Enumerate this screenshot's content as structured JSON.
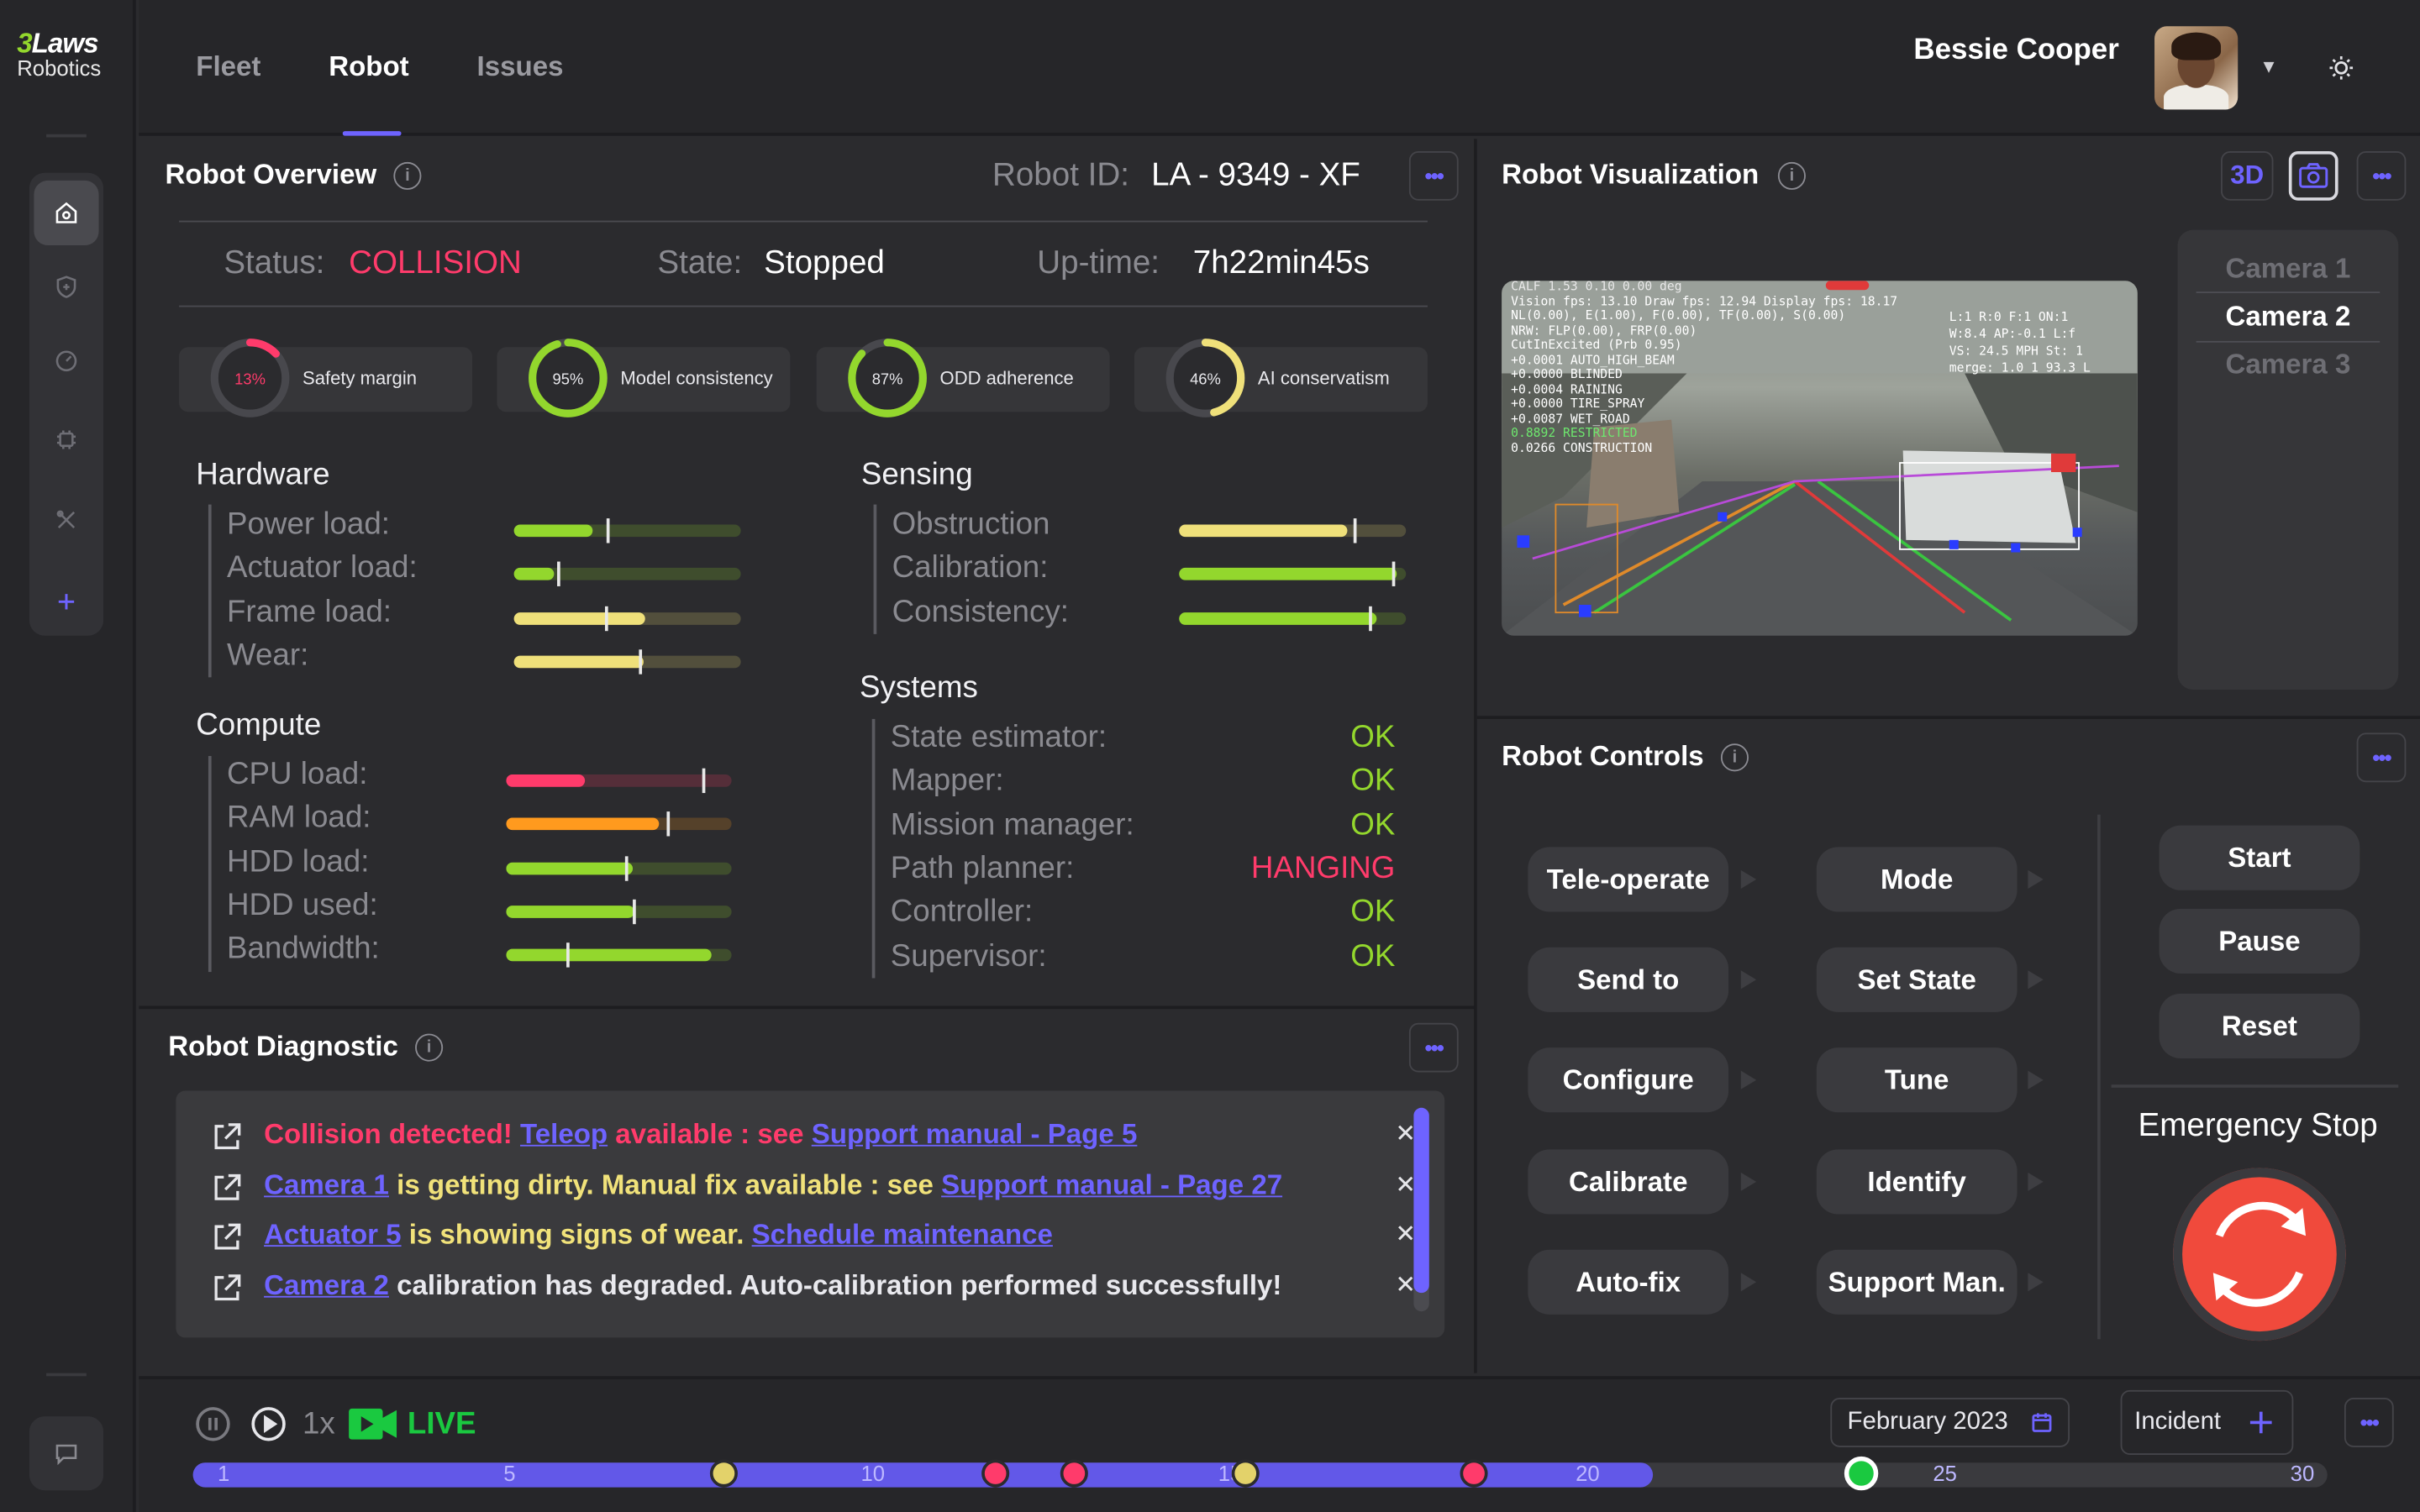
{
  "brand": {
    "line1_num": "3",
    "line1_word": "Laws",
    "line2": "Robotics"
  },
  "nav": {
    "tabs": [
      "Fleet",
      "Robot",
      "Issues"
    ],
    "active": "Robot"
  },
  "user": {
    "name": "Bessie Cooper"
  },
  "overview": {
    "title": "Robot Overview",
    "robot_id_label": "Robot ID:",
    "robot_id": "LA - 9349 - XF",
    "status_label": "Status:",
    "status": "COLLISION",
    "state_label": "State:",
    "state": "Stopped",
    "uptime_label": "Up-time:",
    "uptime": "7h22min45s",
    "gauges": [
      {
        "pct_text": "13%",
        "value": 0.13,
        "label": "Safety margin",
        "color": "#ff3b6b"
      },
      {
        "pct_text": "95%",
        "value": 0.95,
        "label": "Model consistency",
        "color": "#93d72d"
      },
      {
        "pct_text": "87%",
        "value": 0.87,
        "label": "ODD adherence",
        "color": "#93d72d"
      },
      {
        "pct_text": "46%",
        "value": 0.46,
        "label": "AI conservatism",
        "color": "#efe07a"
      }
    ],
    "hardware": {
      "title": "Hardware",
      "rows": [
        {
          "label": "Power load:",
          "fill": 0.35,
          "tick": 0.41,
          "color": "#93d72d"
        },
        {
          "label": "Actuator load:",
          "fill": 0.18,
          "tick": 0.19,
          "color": "#93d72d"
        },
        {
          "label": "Frame load:",
          "fill": 0.58,
          "tick": 0.4,
          "color": "#efe07a"
        },
        {
          "label": "Wear:",
          "fill": 0.57,
          "tick": 0.55,
          "color": "#efe07a"
        }
      ]
    },
    "compute": {
      "title": "Compute",
      "rows": [
        {
          "label": "CPU load:",
          "fill": 0.35,
          "tick": 0.87,
          "color": "#ff3b6b"
        },
        {
          "label": "RAM load:",
          "fill": 0.68,
          "tick": 0.71,
          "color": "#ff9a1e"
        },
        {
          "label": "HDD load:",
          "fill": 0.56,
          "tick": 0.53,
          "color": "#93d72d"
        },
        {
          "label": "HDD used:",
          "fill": 0.57,
          "tick": 0.56,
          "color": "#93d72d"
        },
        {
          "label": "Bandwidth:",
          "fill": 0.91,
          "tick": 0.27,
          "color": "#93d72d"
        }
      ]
    },
    "sensing": {
      "title": "Sensing",
      "rows": [
        {
          "label": "Obstruction",
          "fill": 0.74,
          "tick": 0.77,
          "color": "#efe07a"
        },
        {
          "label": "Calibration:",
          "fill": 0.96,
          "tick": 0.94,
          "color": "#93d72d"
        },
        {
          "label": "Consistency:",
          "fill": 0.87,
          "tick": 0.84,
          "color": "#93d72d"
        }
      ]
    },
    "systems": {
      "title": "Systems",
      "rows": [
        {
          "label": "State estimator:",
          "value": "OK",
          "color": "#93d72d"
        },
        {
          "label": "Mapper:",
          "value": "OK",
          "color": "#93d72d"
        },
        {
          "label": "Mission manager:",
          "value": "OK",
          "color": "#93d72d"
        },
        {
          "label": "Path planner:",
          "value": "HANGING",
          "color": "#ff3b6b"
        },
        {
          "label": "Controller:",
          "value": "OK",
          "color": "#93d72d"
        },
        {
          "label": "Supervisor:",
          "value": "OK",
          "color": "#93d72d"
        }
      ]
    }
  },
  "diagnostic": {
    "title": "Robot Diagnostic",
    "messages": [
      {
        "parts": [
          {
            "t": "Collision detected! ",
            "c": "c-red"
          },
          {
            "t": "Teleop",
            "c": "lnk"
          },
          {
            "t": " available : see ",
            "c": "c-red"
          },
          {
            "t": "Support manual - Page 5",
            "c": "lnk"
          }
        ]
      },
      {
        "parts": [
          {
            "t": "Camera 1",
            "c": "lnk"
          },
          {
            "t": " is getting dirty. Manual fix available : see ",
            "c": "c-yel"
          },
          {
            "t": "Support manual - Page 27",
            "c": "lnk"
          }
        ]
      },
      {
        "parts": [
          {
            "t": "Actuator 5",
            "c": "lnk"
          },
          {
            "t": " is showing signs of wear. ",
            "c": "c-yel"
          },
          {
            "t": "Schedule maintenance",
            "c": "lnk"
          }
        ]
      },
      {
        "parts": [
          {
            "t": "Camera 2",
            "c": "lnk"
          },
          {
            "t": " calibration has degraded. Auto-calibration performed successfully!",
            "c": "c-wht"
          }
        ]
      }
    ]
  },
  "visualization": {
    "title": "Robot Visualization",
    "btn_3d": "3D",
    "cameras": [
      "Camera 1",
      "Camera 2",
      "Camera 3"
    ],
    "active_camera": "Camera 2",
    "overlay_left": [
      "Vision fps: 13.10 Draw fps: 12.94 Display fps: 18.17",
      "NL(0.00), E(1.00), F(0.00), TF(0.00), S(0.00)",
      "NRW: FLP(0.00), FRP(0.00)",
      "CutInExcited (Prb 0.95)",
      "+0.0001 AUTO_HIGH_BEAM",
      "+0.0000 BLINDED",
      "+0.0004 RAINING",
      "+0.0000 TIRE_SPRAY",
      "+0.0087 WET_ROAD",
      "0.8892 RESTRICTED",
      "0.0266 CONSTRUCTION"
    ],
    "overlay_right": [
      "L:1  R:0  F:1  ON:1",
      "W:8.4  AP:-0.1  L:f",
      "VS: 24.5 MPH  St: 1",
      "merge: 1.0  1  93.3  L"
    ],
    "overlay_top": "CALF  1.53  0.10  0.00 deg"
  },
  "controls": {
    "title": "Robot Controls",
    "left_col": [
      "Tele-operate",
      "Send to",
      "Configure",
      "Calibrate",
      "Auto-fix"
    ],
    "mid_col": [
      "Mode",
      "Set State",
      "Tune",
      "Identify",
      "Support Man."
    ],
    "actions": [
      "Start",
      "Pause",
      "Reset"
    ],
    "estop_label": "Emergency Stop"
  },
  "timeline": {
    "speed": "1x",
    "live": "LIVE",
    "date": "February 2023",
    "incident": "Incident",
    "ticks": [
      {
        "n": "1",
        "v": 1
      },
      {
        "n": "5",
        "v": 5
      },
      {
        "n": "10",
        "v": 10
      },
      {
        "n": "15",
        "v": 15
      },
      {
        "n": "20",
        "v": 20
      },
      {
        "n": "25",
        "v": 25
      },
      {
        "n": "30",
        "v": 30
      }
    ],
    "range": [
      1,
      30
    ],
    "progress_day": 21,
    "events": [
      {
        "day": 8.0,
        "color": "#e3d26a"
      },
      {
        "day": 11.8,
        "color": "#ff3b6b"
      },
      {
        "day": 12.9,
        "color": "#ff3b6b"
      },
      {
        "day": 15.3,
        "color": "#e3d26a"
      },
      {
        "day": 18.5,
        "color": "#ff3b6b"
      },
      {
        "day": 23.9,
        "color": "#1ac940"
      }
    ]
  }
}
